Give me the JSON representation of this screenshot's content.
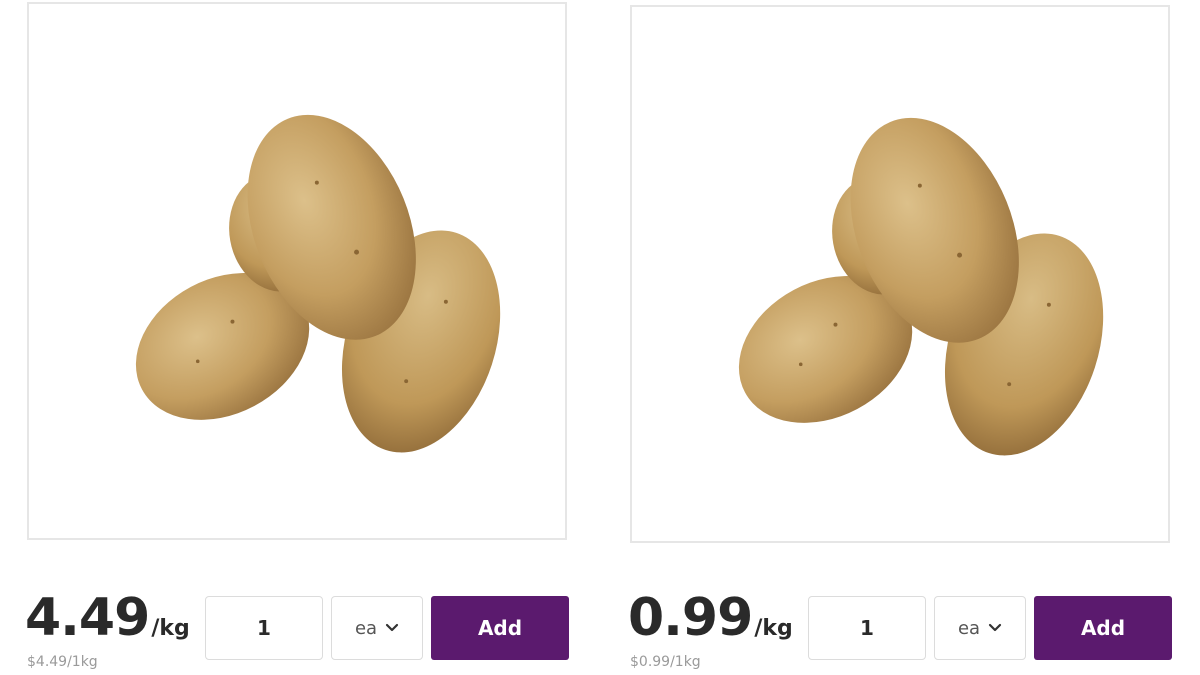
{
  "colors": {
    "accent": "#5b1a6e",
    "border": "#dcdcdc",
    "muted_text": "#9a9a9a"
  },
  "products": [
    {
      "image": "potato-image",
      "price": "4.49",
      "price_unit": "/kg",
      "unit_price": "$4.49/1kg",
      "quantity": "1",
      "unit": "ea",
      "add_label": "Add"
    },
    {
      "image": "potato-image",
      "price": "0.99",
      "price_unit": "/kg",
      "unit_price": "$0.99/1kg",
      "quantity": "1",
      "unit": "ea",
      "add_label": "Add"
    }
  ]
}
